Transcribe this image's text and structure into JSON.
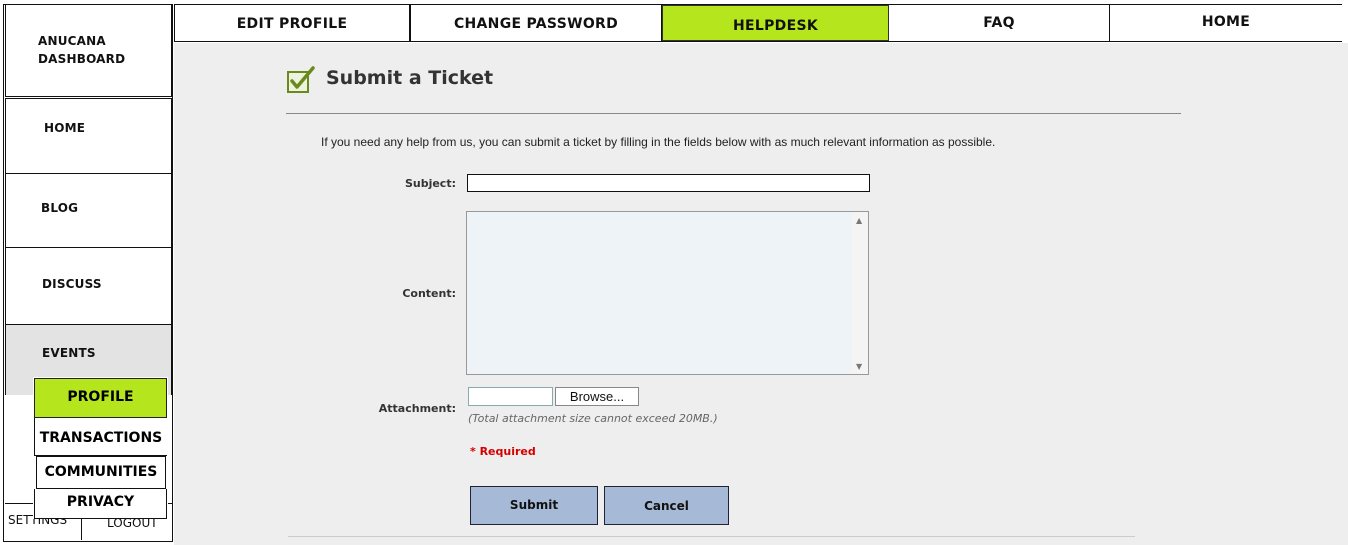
{
  "sidebar": {
    "dashboard": "ANUCANA\nDASHBOARD",
    "dashboard_line1": "ANUCANA",
    "dashboard_line2": "DASHBOARD",
    "home": "HOME",
    "blog": "BLOG",
    "discuss": "DISCUSS",
    "events": "EVENTS",
    "settings": "SETTINGS",
    "logout": "LOGOUT"
  },
  "popup_menu": {
    "profile": "PROFILE",
    "transactions": "TRANSACTIONS",
    "communities": "COMMUNITIES",
    "privacy": "PRIVACY"
  },
  "topnav": {
    "edit_profile": "EDIT PROFILE",
    "change_password": "CHANGE PASSWORD",
    "helpdesk": "HELPDESK",
    "faq": "FAQ",
    "home": "HOME",
    "active_tab": "HELPDESK"
  },
  "ticket_form": {
    "title": "Submit a Ticket",
    "intro": "If you need any help from us, you can submit a ticket by filling in the fields below with as much relevant information as possible.",
    "subject_label": "Subject:",
    "subject_value": "",
    "content_label": "Content:",
    "content_value": "",
    "attachment_label": "Attachment:",
    "browse_label": "Browse...",
    "attachment_note": "(Total attachment size cannot exceed 20MB.)",
    "required_text": "* Required",
    "submit_label": "Submit",
    "cancel_label": "Cancel"
  },
  "colors": {
    "accent_green": "#b5e61d",
    "button_blue": "#a6b9d6",
    "required_red": "#d40000",
    "content_background": "#eeeeee"
  },
  "icons": {
    "title_icon": "checkbox-checked-icon"
  }
}
